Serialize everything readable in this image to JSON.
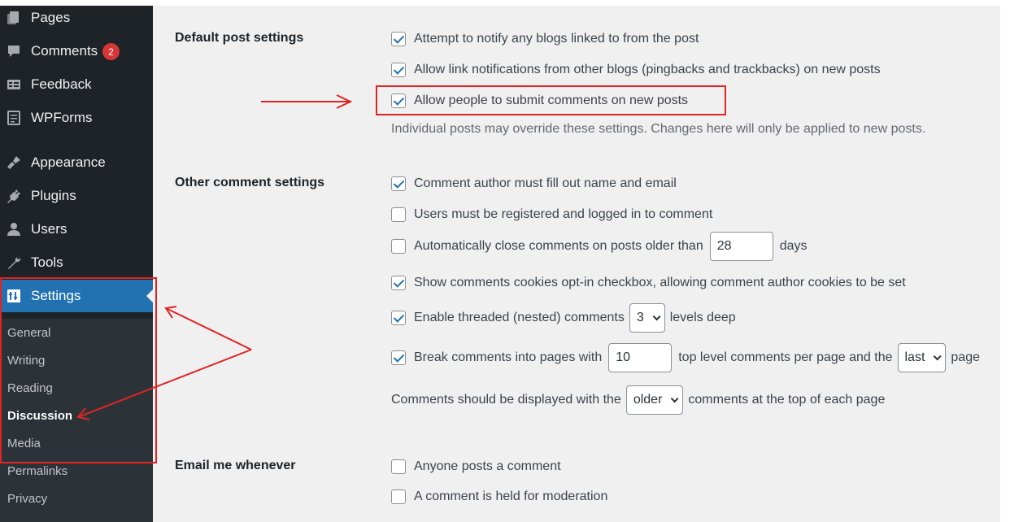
{
  "sidebar": {
    "items": [
      {
        "label": "Pages",
        "icon": "pages-icon"
      },
      {
        "label": "Comments",
        "icon": "comments-icon",
        "badge": "2"
      },
      {
        "label": "Feedback",
        "icon": "feedback-icon"
      },
      {
        "label": "WPForms",
        "icon": "wpforms-icon"
      },
      {
        "label": "Appearance",
        "icon": "appearance-icon"
      },
      {
        "label": "Plugins",
        "icon": "plugins-icon"
      },
      {
        "label": "Users",
        "icon": "users-icon"
      },
      {
        "label": "Tools",
        "icon": "tools-icon"
      },
      {
        "label": "Settings",
        "icon": "settings-icon",
        "active": true
      }
    ],
    "submenu": [
      "General",
      "Writing",
      "Reading",
      "Discussion",
      "Media",
      "Permalinks",
      "Privacy"
    ],
    "current_submenu": "Discussion"
  },
  "sections": {
    "default_post": {
      "title": "Default post settings",
      "options": [
        {
          "label": "Attempt to notify any blogs linked to from the post",
          "checked": true
        },
        {
          "label": "Allow link notifications from other blogs (pingbacks and trackbacks) on new posts",
          "checked": true
        },
        {
          "label": "Allow people to submit comments on new posts",
          "checked": true
        }
      ],
      "description": "Individual posts may override these settings. Changes here will only be applied to new posts."
    },
    "other_comment": {
      "title": "Other comment settings",
      "name_email": {
        "label": "Comment author must fill out name and email",
        "checked": true
      },
      "registered": {
        "label": "Users must be registered and logged in to comment",
        "checked": false
      },
      "auto_close": {
        "label": "Automatically close comments on posts older than",
        "value": "28",
        "suffix": "days",
        "checked": false
      },
      "cookies": {
        "label": "Show comments cookies opt-in checkbox, allowing comment author cookies to be set",
        "checked": true
      },
      "threaded": {
        "label": "Enable threaded (nested) comments",
        "value": "3",
        "suffix": "levels deep",
        "checked": true
      },
      "paged": {
        "label": "Break comments into pages with",
        "value": "10",
        "middle": "top level comments per page and the",
        "select": "last",
        "suffix": "page",
        "checked": true
      },
      "order": {
        "prefix": "Comments should be displayed with the",
        "select": "older",
        "suffix": "comments at the top of each page"
      }
    },
    "email": {
      "title": "Email me whenever",
      "options": [
        {
          "label": "Anyone posts a comment",
          "checked": false
        },
        {
          "label": "A comment is held for moderation",
          "checked": false
        }
      ]
    }
  },
  "annotation_color": "#e02424",
  "accent": "#2271b1"
}
